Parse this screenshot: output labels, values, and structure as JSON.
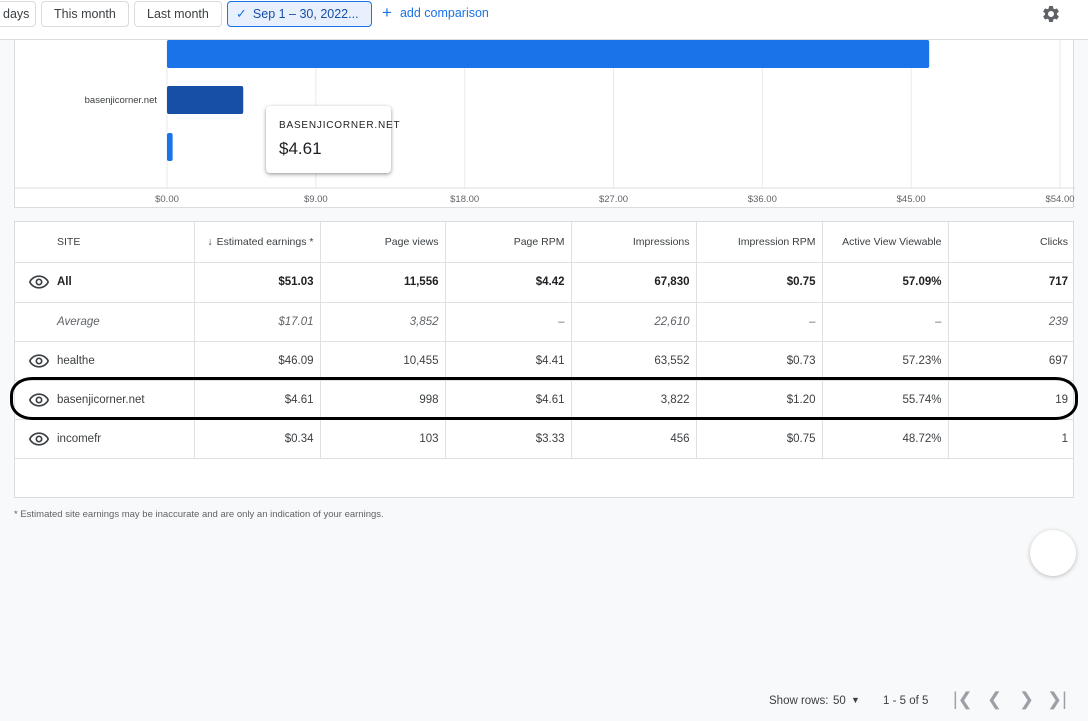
{
  "toolbar": {
    "chips": [
      {
        "label": "days"
      },
      {
        "label": "This month"
      },
      {
        "label": "Last month"
      },
      {
        "label": "Sep 1 – 30, 2022..."
      }
    ],
    "add_comparison": "add comparison",
    "icons": {
      "check": "check-icon",
      "plus": "plus-icon",
      "settings": "gear-icon"
    }
  },
  "chart_data": {
    "type": "bar",
    "orientation": "horizontal",
    "categories": [
      "",
      "basenjicorner.net",
      ""
    ],
    "values": [
      46.09,
      4.61,
      0.34
    ],
    "xlim": [
      0,
      54
    ],
    "xticks": [
      "$0.00",
      "$9.00",
      "$18.00",
      "$27.00",
      "$36.00",
      "$45.00",
      "$54.00"
    ],
    "grid": true,
    "colors": [
      "#1a73e8",
      "#174ea6",
      "#1a73e8"
    ],
    "highlight_index": 1
  },
  "tooltip": {
    "title": "BASENJICORNER.NET",
    "value": "$4.61"
  },
  "table": {
    "headers": [
      "SITE",
      "Estimated earnings *",
      "Page views",
      "Page RPM",
      "Impressions",
      "Impression RPM",
      "Active View Viewable",
      "Clicks"
    ],
    "sort_arrow": "↓",
    "rows": [
      {
        "type": "total",
        "eye": true,
        "cells": [
          "All",
          "$51.03",
          "11,556",
          "$4.42",
          "67,830",
          "$0.75",
          "57.09%",
          "717"
        ]
      },
      {
        "type": "avg",
        "eye": false,
        "cells": [
          "Average",
          "$17.01",
          "3,852",
          "–",
          "22,610",
          "–",
          "–",
          "239"
        ]
      },
      {
        "type": "row",
        "eye": true,
        "cells": [
          "healthe",
          "$46.09",
          "10,455",
          "$4.41",
          "63,552",
          "$0.73",
          "57.23%",
          "697"
        ]
      },
      {
        "type": "row",
        "eye": true,
        "cells": [
          "basenjicorner.net",
          "$4.61",
          "998",
          "$4.61",
          "3,822",
          "$1.20",
          "55.74%",
          "19"
        ]
      },
      {
        "type": "row",
        "eye": true,
        "cells": [
          "incomefr",
          "$0.34",
          "103",
          "$3.33",
          "456",
          "$0.75",
          "48.72%",
          "1"
        ]
      }
    ]
  },
  "pagination": {
    "show_rows_label": "Show rows:",
    "rows_value": "50",
    "range": "1 - 5 of 5",
    "first": "|❮",
    "prev": "❮",
    "next": "❯",
    "last": "❯|"
  },
  "footnote": "* Estimated site earnings may be inaccurate and are only an indication of your earnings."
}
